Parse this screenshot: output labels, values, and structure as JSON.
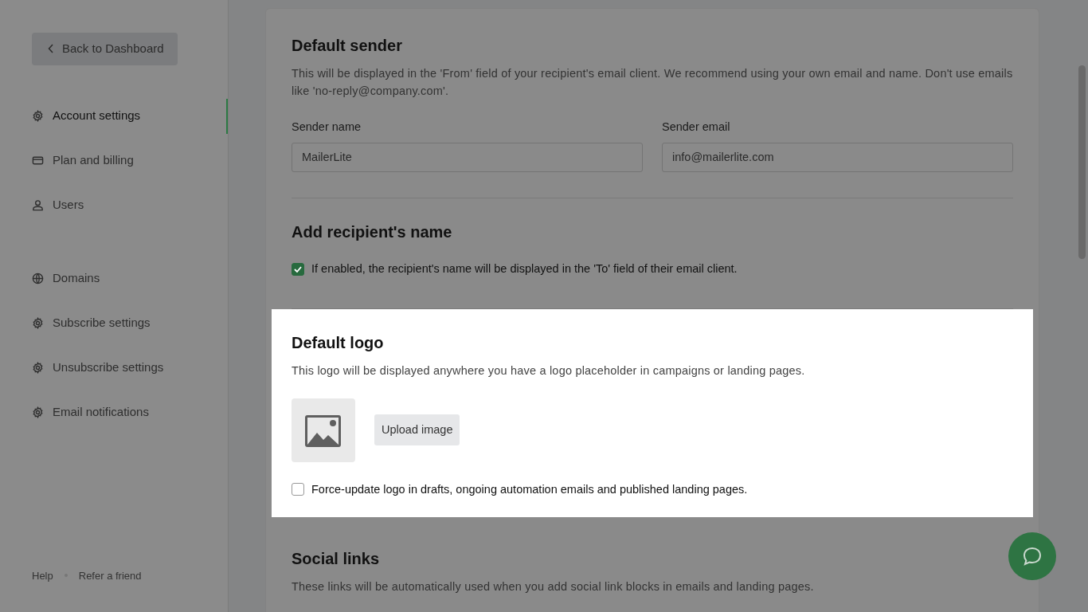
{
  "back_button": {
    "label": "Back to Dashboard"
  },
  "sidebar": {
    "groups": [
      [
        {
          "label": "Account settings",
          "selected": true
        },
        {
          "label": "Plan and billing",
          "selected": false
        },
        {
          "label": "Users",
          "selected": false
        }
      ],
      [
        {
          "label": "Domains",
          "selected": false
        },
        {
          "label": "Subscribe settings",
          "selected": false
        },
        {
          "label": "Unsubscribe settings",
          "selected": false
        },
        {
          "label": "Email notifications",
          "selected": false
        }
      ]
    ],
    "footer_links": [
      "Help",
      "Refer a friend"
    ]
  },
  "sections": [
    {
      "kind": "fields",
      "highlighted": false,
      "title": "Default sender",
      "description": "This will be displayed in the 'From' field of your recipient's email client. We recommend using your own email and name. Don't use emails like 'no-reply@company.com'.",
      "fields": [
        {
          "label": "Sender name",
          "value": "MailerLite"
        },
        {
          "label": "Sender email",
          "value": "info@mailerlite.com"
        }
      ]
    },
    {
      "kind": "checkbox",
      "highlighted": false,
      "title": "Add recipient's name",
      "checkbox": {
        "label": "If enabled, the recipient's name will be displayed in the 'To' field of their email client.",
        "checked": true
      }
    },
    {
      "kind": "logo",
      "highlighted": true,
      "title": "Default logo",
      "description": "This logo will be displayed anywhere you have a logo placeholder in campaigns or landing pages.",
      "button": "Upload image",
      "checkbox": {
        "label": "Force-update logo in drafts, ongoing automation emails and published landing pages.",
        "checked": false
      }
    },
    {
      "kind": "text",
      "highlighted": false,
      "title": "Social links",
      "description": "These links will be automatically used when you add social link blocks in emails and landing pages."
    }
  ]
}
